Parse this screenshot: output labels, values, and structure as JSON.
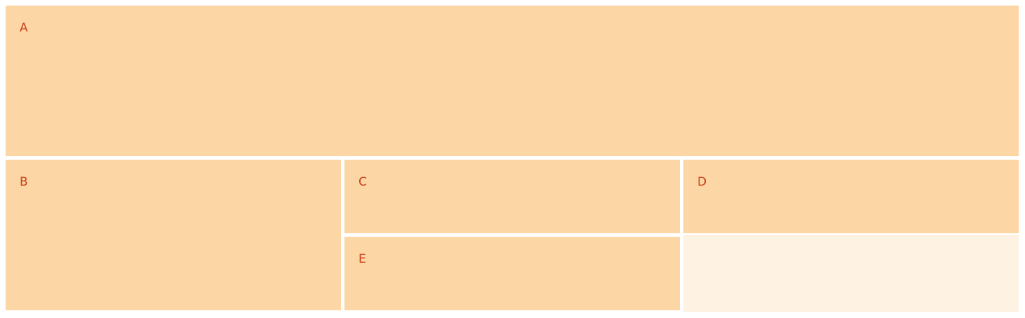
{
  "colors": {
    "cell_fill": "#fdd6a6",
    "empty_fill": "#fef2e3",
    "label_color": "#c8401a",
    "background": "#ffffff"
  },
  "cells": {
    "a": {
      "label": "A"
    },
    "b": {
      "label": "B"
    },
    "c": {
      "label": "C"
    },
    "d": {
      "label": "D"
    },
    "e": {
      "label": "E"
    }
  }
}
